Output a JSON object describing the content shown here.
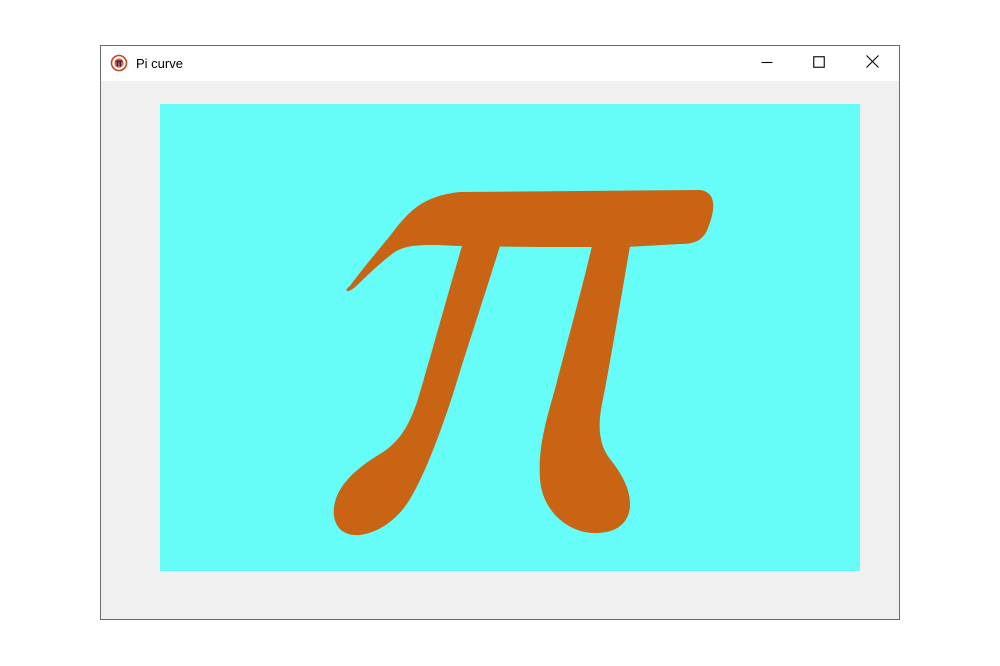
{
  "window": {
    "title": "Pi curve",
    "app_icon": "app-logo-icon",
    "controls": {
      "minimize_icon": "minimize-icon",
      "maximize_icon": "maximize-icon",
      "close_icon": "close-icon"
    }
  },
  "canvas": {
    "background_color": "#66fcf7",
    "shape": "pi-symbol",
    "shape_color": "#c86414"
  },
  "colors": {
    "window_frame": "#f0f0f0",
    "titlebar": "#ffffff"
  }
}
